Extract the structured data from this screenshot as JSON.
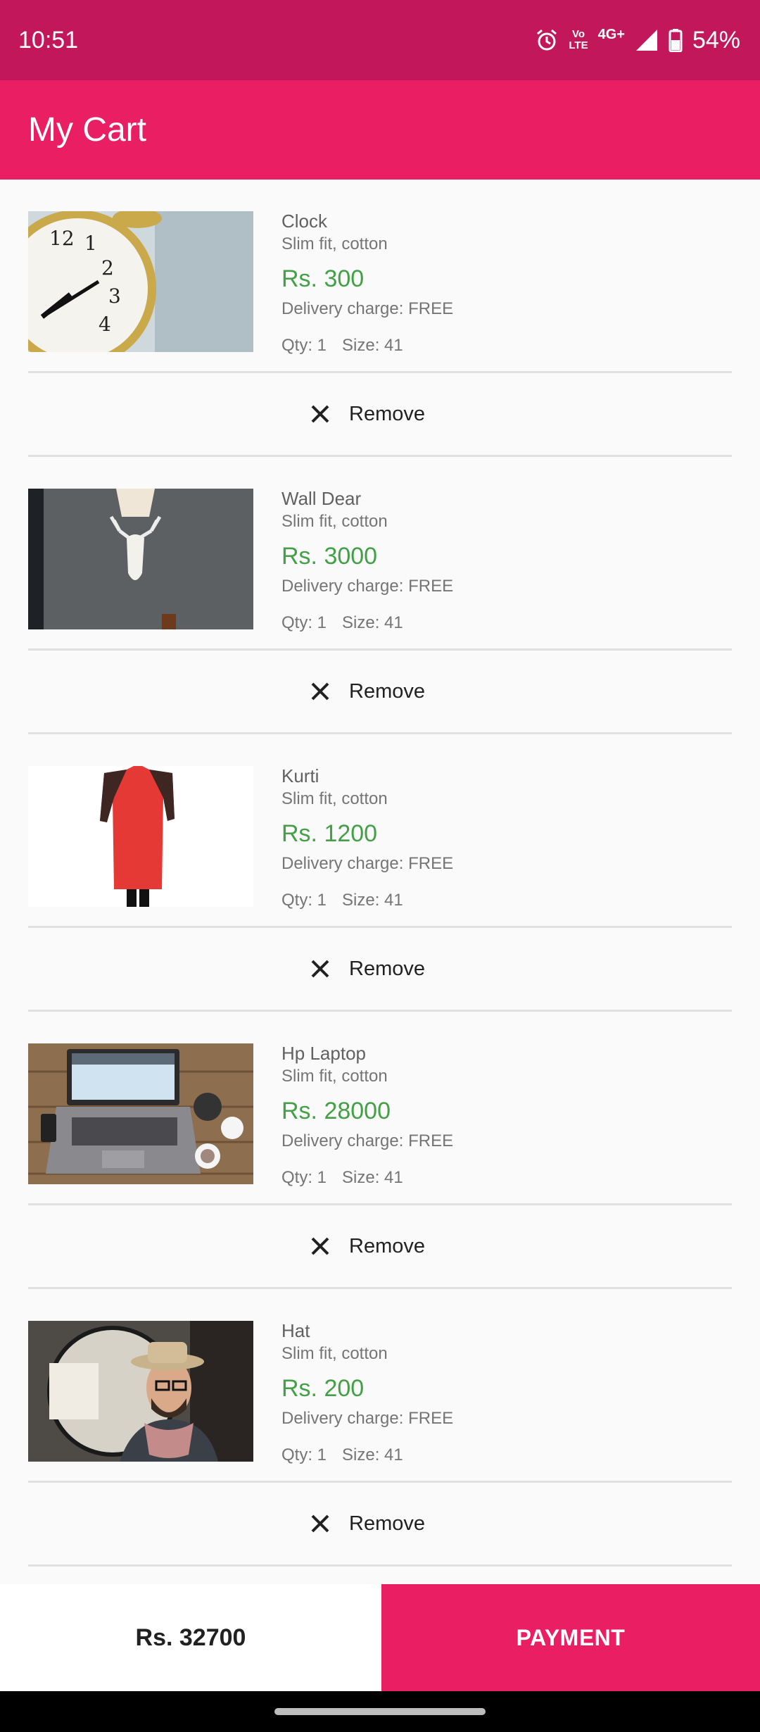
{
  "status_bar": {
    "time": "10:51",
    "volte_top": "Vo",
    "volte_bottom": "LTE",
    "network": "4G+",
    "battery": "54%",
    "icons": [
      "alarm-icon",
      "volte-icon",
      "signal-icon",
      "battery-icon"
    ]
  },
  "app_bar": {
    "title": "My Cart"
  },
  "items": [
    {
      "name": "Clock",
      "desc": "Slim fit, cotton",
      "price": "Rs. 300",
      "delivery": "Delivery charge: FREE",
      "qty": "Qty: 1",
      "size": "Size: 41",
      "remove_label": "Remove",
      "thumb": "alarm-clock-photo"
    },
    {
      "name": "Wall Dear",
      "desc": "Slim fit, cotton",
      "price": "Rs. 3000",
      "delivery": "Delivery charge: FREE",
      "qty": "Qty: 1",
      "size": "Size: 41",
      "remove_label": "Remove",
      "thumb": "deer-head-photo"
    },
    {
      "name": "Kurti",
      "desc": "Slim fit, cotton",
      "price": "Rs. 1200",
      "delivery": "Delivery charge: FREE",
      "qty": "Qty: 1",
      "size": "Size: 41",
      "remove_label": "Remove",
      "thumb": "kurti-photo"
    },
    {
      "name": "Hp Laptop",
      "desc": "Slim fit, cotton",
      "price": "Rs. 28000",
      "delivery": "Delivery charge: FREE",
      "qty": "Qty: 1",
      "size": "Size: 41",
      "remove_label": "Remove",
      "thumb": "laptop-photo"
    },
    {
      "name": "Hat",
      "desc": "Slim fit, cotton",
      "price": "Rs. 200",
      "delivery": "Delivery charge: FREE",
      "qty": "Qty: 1",
      "size": "Size: 41",
      "remove_label": "Remove",
      "thumb": "hat-photo"
    }
  ],
  "footer": {
    "total": "Rs. 32700",
    "payment_label": "PAYMENT"
  },
  "colors": {
    "status_bar": "#c2185b",
    "primary": "#e91e63",
    "price": "#43a047"
  }
}
